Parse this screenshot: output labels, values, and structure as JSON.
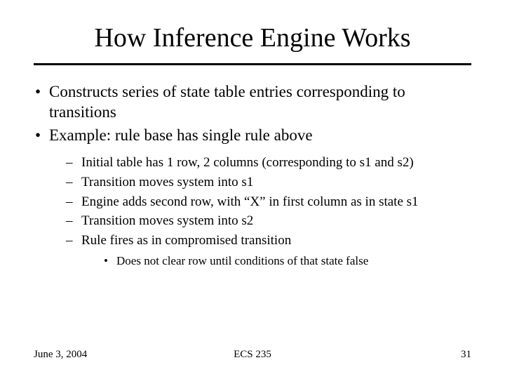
{
  "title": "How Inference Engine Works",
  "bullets": [
    "Constructs series of state table entries corresponding to transitions",
    "Example: rule base has single rule above"
  ],
  "sub": [
    "Initial table has 1 row, 2 columns (corresponding to s1 and s2)",
    "Transition moves system into s1",
    "Engine adds second row, with “X” in first column as in state s1",
    "Transition moves system into s2",
    "Rule fires as in compromised transition"
  ],
  "subsub": [
    "Does not clear row until conditions of that state false"
  ],
  "footer": {
    "date": "June 3, 2004",
    "course": "ECS 235",
    "page": "31"
  }
}
